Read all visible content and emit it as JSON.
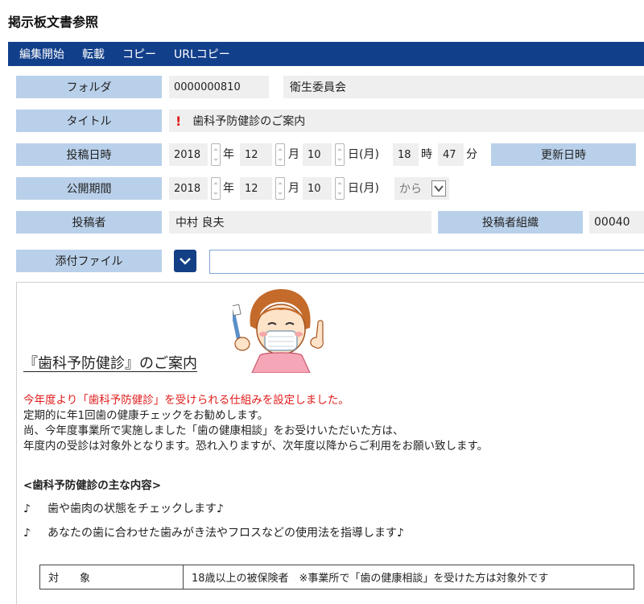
{
  "window": {
    "title": "掲示板文書参照"
  },
  "menu": [
    "編集開始",
    "転載",
    "コピー",
    "URLコピー"
  ],
  "form": {
    "folder": {
      "label": "フォルダ",
      "code": "0000000810",
      "name": "衛生委員会"
    },
    "title": {
      "label": "タイトル",
      "importance_mark": "!",
      "value": "歯科予防健診のご案内"
    },
    "posted": {
      "label": "投稿日時",
      "year": "2018",
      "year_unit": "年",
      "month": "12",
      "month_unit": "月",
      "day": "10",
      "day_unit": "日(月)",
      "hour": "18",
      "hour_unit": "時",
      "minute": "47",
      "minute_unit": "分"
    },
    "updated": {
      "label": "更新日時"
    },
    "period": {
      "label": "公開期間",
      "year": "2018",
      "year_unit": "年",
      "month": "12",
      "month_unit": "月",
      "day": "10",
      "day_unit": "日(月)",
      "range_select": "から"
    },
    "poster": {
      "label": "投稿者",
      "value": "中村 良夫"
    },
    "poster_org": {
      "label": "投稿者組織",
      "value": "00040"
    },
    "attachment": {
      "label": "添付ファイル"
    }
  },
  "body": {
    "heading": "『歯科予防健診』のご案内",
    "lines": [
      "今年度より「歯科予防健診」を受けられる仕組みを設定しました。",
      "定期的に年1回歯の健康チェックをお勧めします。",
      "尚、今年度事業所で実施しました「歯の健康相談」をお受けいただいた方は、",
      "年度内の受診は対象外となります。恐れ入りますが、次年度以降からご利用をお願い致します。"
    ],
    "section_title": "<歯科予防健診の主な内容>",
    "bullet_mark": "♪",
    "bullets": [
      "歯や歯肉の状態をチェックします♪",
      "あなたの歯に合わせた歯みがき法やフロスなどの使用法を指導します♪"
    ],
    "table": [
      {
        "key": "対　　象",
        "value": "18歳以上の被保険者　※事業所で「歯の健康相談」を受けた方は対象外です"
      }
    ]
  }
}
